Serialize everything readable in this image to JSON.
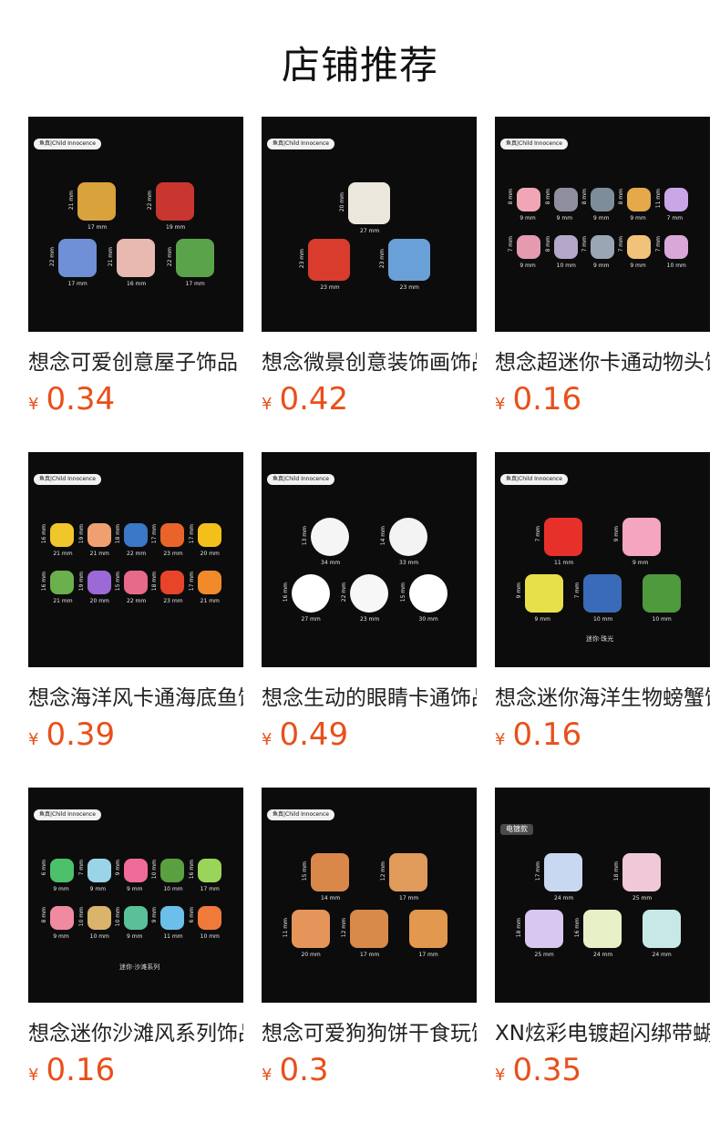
{
  "section_title": "店铺推荐",
  "brand_badge": "鱼真|Child Innocence",
  "hot_badge": "电镀款",
  "currency": "¥",
  "products": [
    {
      "name": "想念可爱创意屋子饰品",
      "price": "0.34",
      "dims": [
        "17 mm",
        "19 mm",
        "17 mm",
        "16 mm",
        "17 mm"
      ],
      "vdims": [
        "21 mm",
        "22 mm",
        "22 mm",
        "21 mm",
        "22 mm"
      ]
    },
    {
      "name": "想念微景创意装饰画饰品",
      "price": "0.42",
      "dims": [
        "27 mm",
        "23 mm",
        "23 mm"
      ],
      "vdims": [
        "20 mm",
        "23 mm",
        "23 mm"
      ]
    },
    {
      "name": "想念超迷你卡通动物头饰品",
      "price": "0.16",
      "dims": [
        "9 mm",
        "9 mm",
        "9 mm",
        "9 mm",
        "7 mm",
        "9 mm",
        "10 mm",
        "9 mm",
        "9 mm",
        "10 mm"
      ],
      "vdims": [
        "8 mm",
        "8 mm",
        "8 mm",
        "8 mm",
        "11 mm",
        "7 mm",
        "8 mm",
        "7 mm",
        "7 mm",
        "7 mm"
      ]
    },
    {
      "name": "想念海洋风卡通海底鱼饰品",
      "price": "0.39",
      "dims": [
        "21 mm",
        "21 mm",
        "22 mm",
        "23 mm",
        "20 mm",
        "21 mm",
        "20 mm",
        "22 mm",
        "23 mm",
        "21 mm"
      ],
      "vdims": [
        "16 mm",
        "19 mm",
        "18 mm",
        "17 mm",
        "17 mm",
        "16 mm",
        "19 mm",
        "15 mm",
        "18 mm",
        "17 mm"
      ]
    },
    {
      "name": "想念生动的眼睛卡通饰品",
      "price": "0.49",
      "dims": [
        "34 mm",
        "33 mm",
        "27 mm",
        "23 mm",
        "30 mm"
      ],
      "vdims": [
        "13 mm",
        "14 mm",
        "16 mm",
        "22 mm",
        "15 mm"
      ]
    },
    {
      "name": "想念迷你海洋生物螃蟹饰品",
      "price": "0.16",
      "dims": [
        "11 mm",
        "9 mm",
        "9 mm",
        "10 mm",
        "10 mm"
      ],
      "vdims": [
        "7 mm",
        "9 mm",
        "9 mm",
        "7 mm"
      ],
      "caption": "迷你·珠光"
    },
    {
      "name": "想念迷你沙滩风系列饰品",
      "price": "0.16",
      "dims": [
        "9 mm",
        "9 mm",
        "9 mm",
        "10 mm",
        "17 mm",
        "9 mm",
        "10 mm",
        "9 mm",
        "11 mm",
        "10 mm"
      ],
      "vdims": [
        "6 mm",
        "7 mm",
        "9 mm",
        "10 mm",
        "16 mm",
        "8 mm",
        "10 mm",
        "10 mm",
        "9 mm",
        "6 mm"
      ],
      "caption": "迷你·沙滩系列"
    },
    {
      "name": "想念可爱狗狗饼干食玩饰品",
      "price": "0.3",
      "dims": [
        "14 mm",
        "17 mm",
        "20 mm",
        "17 mm",
        "17 mm"
      ],
      "vdims": [
        "15 mm",
        "12 mm",
        "11 mm",
        "12 mm"
      ]
    },
    {
      "name": "XN炫彩电镀超闪绑带蝴蝶结",
      "price": "0.35",
      "dims": [
        "24 mm",
        "25 mm",
        "25 mm",
        "24 mm",
        "24 mm"
      ],
      "vdims": [
        "17 mm",
        "18 mm",
        "18 mm",
        "16 mm"
      ]
    }
  ],
  "colors": {
    "price": "#e8501a",
    "thumb_bg": "#0c0c0c"
  }
}
